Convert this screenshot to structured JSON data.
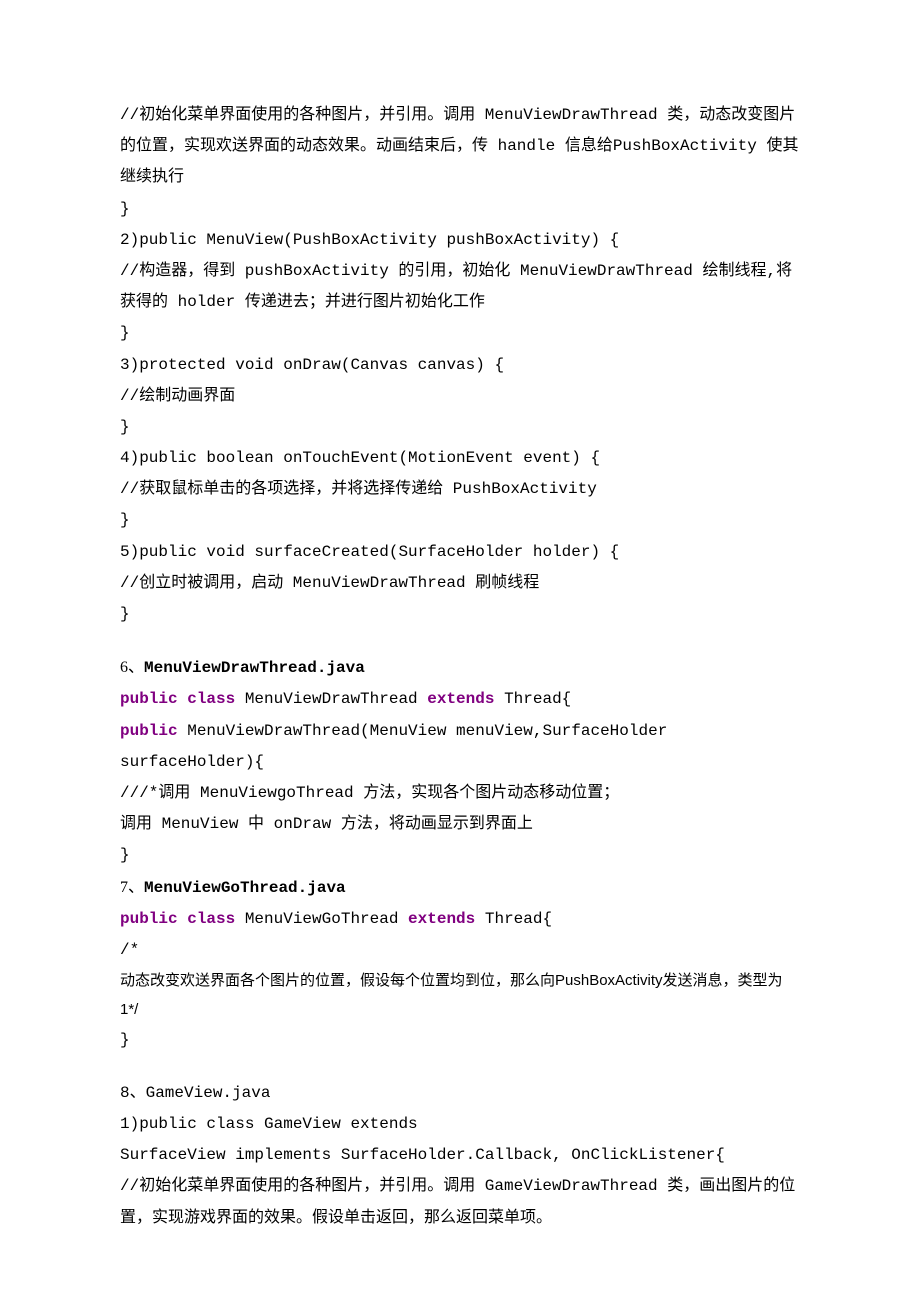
{
  "block1": {
    "l1": "//初始化菜单界面使用的各种图片，并引用。调用 MenuViewDrawThread 类，动态改变图片的位置，实现欢送界面的动态效果。动画结束后，传 handle 信息给PushBoxActivity 使其继续执行",
    "l2": "}",
    "l3": "2)public MenuView(PushBoxActivity pushBoxActivity) {",
    "l4": "//构造器，得到 pushBoxActivity 的引用，初始化 MenuViewDrawThread 绘制线程,将获得的 holder 传递进去；并进行图片初始化工作",
    "l5": "}",
    "l6": "3)protected void onDraw(Canvas canvas) {",
    "l7": "//绘制动画界面",
    "l8": "}",
    "l9": "4)public boolean onTouchEvent(MotionEvent event) {",
    "l10": "//获取鼠标单击的各项选择，并将选择传递给 PushBoxActivity",
    "l11": "}",
    "l12": "5)public void surfaceCreated(SurfaceHolder holder) {",
    "l13": "//创立时被调用，启动 MenuViewDrawThread 刷帧线程",
    "l14": "}"
  },
  "block2": {
    "num6": "6、",
    "title6": "MenuViewDrawThread.java",
    "line6a_pre": "public class",
    "line6a_mid": " MenuViewDrawThread ",
    "line6a_ext": "extends",
    "line6a_post": " Thread{",
    "line6b_pre": "public",
    "line6b_post": " MenuViewDrawThread(MenuView menuView,SurfaceHolder surfaceHolder){",
    "l6c": "///*调用 MenuViewgoThread 方法，实现各个图片动态移动位置；",
    "l6d": "调用 MenuView 中 onDraw 方法，将动画显示到界面上",
    "l6e": "}",
    "num7": "7、",
    "title7": "MenuViewGoThread.java",
    "line7a_pre": "public class",
    "line7a_mid": " MenuViewGoThread ",
    "line7a_ext": "extends",
    "line7a_post": " Thread{",
    "l7b": "/*",
    "l7c": "动态改变欢送界面各个图片的位置，假设每个位置均到位，那么向PushBoxActivity发送消息，类型为1*/",
    "l7d": "}"
  },
  "block3": {
    "l8a": "8、GameView.java",
    "l8b": "1)public class GameView extends",
    "l8c": "SurfaceView implements SurfaceHolder.Callback, OnClickListener{",
    "l8d": "//初始化菜单界面使用的各种图片，并引用。调用 GameViewDrawThread 类，画出图片的位置，实现游戏界面的效果。假设单击返回，那么返回菜单项。"
  }
}
